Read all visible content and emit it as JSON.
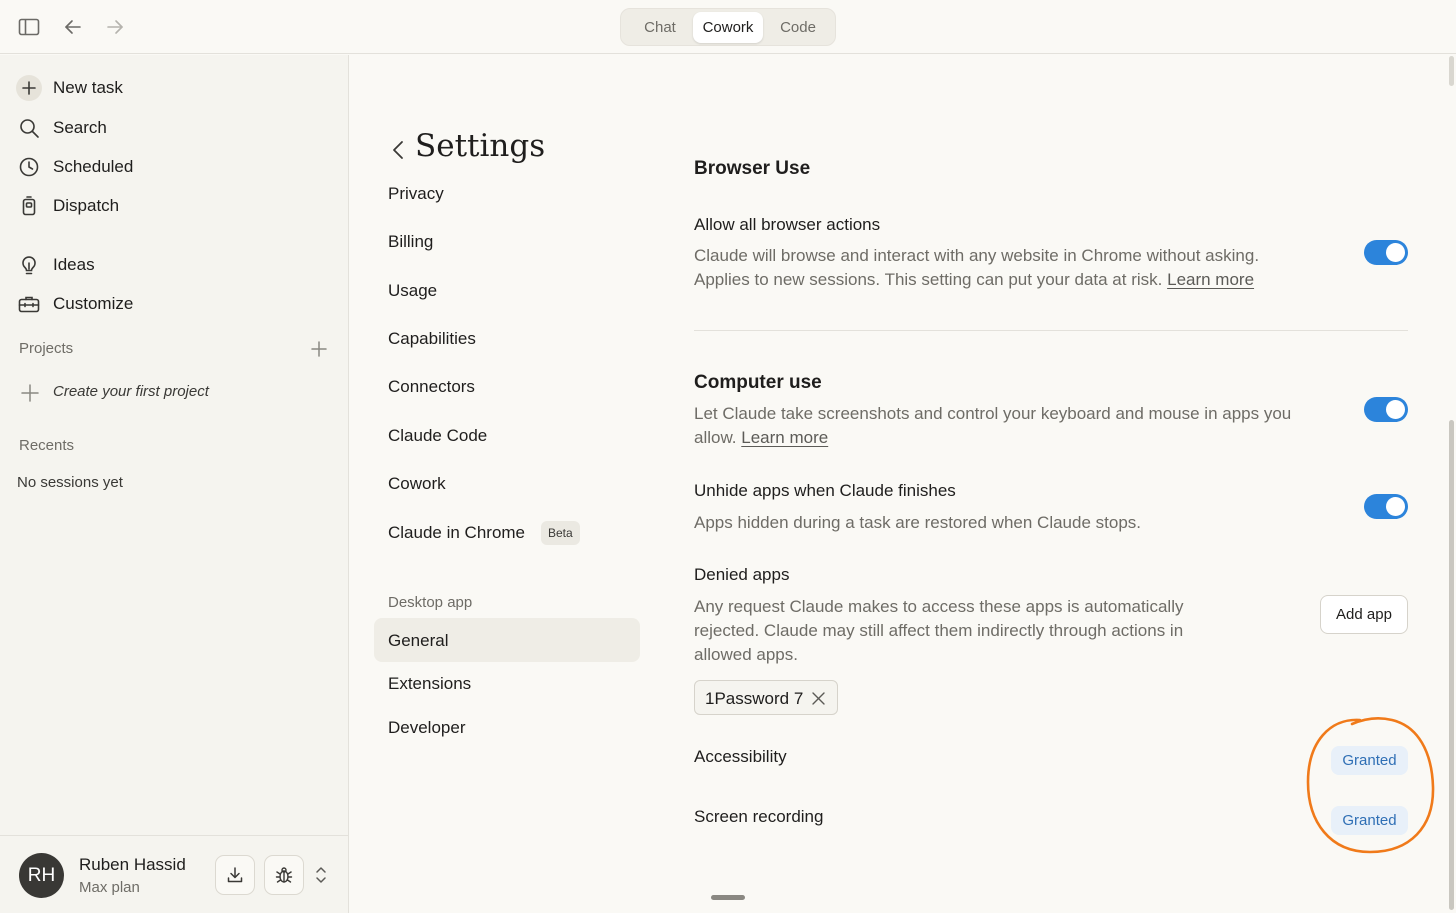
{
  "topbar": {
    "tabs": [
      {
        "label": "Chat",
        "active": false
      },
      {
        "label": "Cowork",
        "active": true
      },
      {
        "label": "Code",
        "active": false
      }
    ]
  },
  "sidebar": {
    "items": [
      {
        "label": "New task",
        "icon": "plus-icon"
      },
      {
        "label": "Search",
        "icon": "search-icon"
      },
      {
        "label": "Scheduled",
        "icon": "clock-icon"
      },
      {
        "label": "Dispatch",
        "icon": "dispatch-icon"
      },
      {
        "label": "Ideas",
        "icon": "lightbulb-icon"
      },
      {
        "label": "Customize",
        "icon": "toolbox-icon"
      }
    ],
    "projects_label": "Projects",
    "create_project": "Create your first project",
    "recents_label": "Recents",
    "no_sessions": "No sessions yet",
    "profile": {
      "initials": "RH",
      "name": "Ruben Hassid",
      "plan": "Max plan"
    }
  },
  "settings": {
    "title": "Settings",
    "nav": [
      "Privacy",
      "Billing",
      "Usage",
      "Capabilities",
      "Connectors",
      "Claude Code",
      "Cowork",
      "Claude in Chrome"
    ],
    "beta_badge": "Beta",
    "desktop_section": "Desktop app",
    "desktop_nav": [
      "General",
      "Extensions",
      "Developer"
    ],
    "active_item": "General"
  },
  "content": {
    "cut_heading": "Browser Use",
    "browser": {
      "title": "Allow all browser actions",
      "desc_line1": "Claude will browse and interact with any website in Chrome without asking.",
      "desc_line2": "Applies to new sessions. This setting can put your data at risk.",
      "link": "Learn more",
      "enabled": true
    },
    "computer_use": {
      "title": "Computer use",
      "desc_line1": "Let Claude take screenshots and control your keyboard and mouse in apps you",
      "desc_line2": "allow.",
      "link": "Learn more",
      "enabled": true
    },
    "unhide": {
      "title": "Unhide apps when Claude finishes",
      "desc": "Apps hidden during a task are restored when Claude stops.",
      "enabled": true
    },
    "denied": {
      "title": "Denied apps",
      "desc_line1": "Any request Claude makes to access these apps is automatically",
      "desc_line2": "rejected. Claude may still affect them indirectly through actions in",
      "desc_line3": "allowed apps.",
      "add_button": "Add app",
      "apps": [
        "1Password 7"
      ]
    },
    "accessibility": {
      "title": "Accessibility",
      "status": "Granted"
    },
    "screen_recording": {
      "title": "Screen recording",
      "status": "Granted"
    }
  },
  "colors": {
    "toggle_on": "#2c84db",
    "granted_text": "#2f6fb5",
    "granted_bg": "#e8f0f9",
    "annotation": "#f07a1a"
  }
}
